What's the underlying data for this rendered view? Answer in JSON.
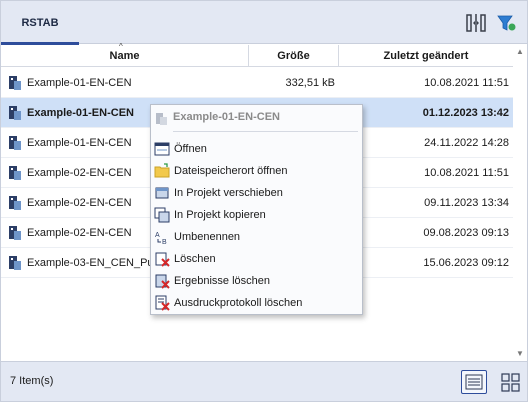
{
  "toolbar": {
    "tab_label": "RSTAB",
    "layout_icon": "split-view-icon",
    "filter_icon": "filter-icon",
    "accent_color": "#2e4d9b"
  },
  "table": {
    "columns": [
      "Name",
      "Größe",
      "Zuletzt geändert"
    ],
    "rows": [
      {
        "name": "Example-01-EN-CEN",
        "size": "332,51 kB",
        "modified": "10.08.2021 11:51",
        "selected": false
      },
      {
        "name": "Example-01-EN-CEN",
        "size": "",
        "modified": "01.12.2023 13:42",
        "selected": true
      },
      {
        "name": "Example-01-EN-CEN",
        "size": "",
        "modified": "24.11.2022 14:28",
        "selected": false
      },
      {
        "name": "Example-02-EN-CEN",
        "size": "",
        "modified": "10.08.2021 11:51",
        "selected": false
      },
      {
        "name": "Example-02-EN-CEN",
        "size": "",
        "modified": "09.11.2023 13:34",
        "selected": false
      },
      {
        "name": "Example-02-EN-CEN",
        "size": "",
        "modified": "09.08.2023 09:13",
        "selected": false
      },
      {
        "name": "Example-03-EN_CEN_Pus",
        "size": "",
        "modified": "15.06.2023 09:12",
        "selected": false
      }
    ],
    "selected_color": "#cfe0f7"
  },
  "context_menu": {
    "title": "Example-01-EN-CEN",
    "items": [
      {
        "label": "Öffnen",
        "icon": "open-window-icon"
      },
      {
        "label": "Dateispeicherort öffnen",
        "icon": "folder-icon"
      },
      {
        "label": "In Projekt verschieben",
        "icon": "move-to-project-icon"
      },
      {
        "label": "In Projekt kopieren",
        "icon": "copy-to-project-icon"
      },
      {
        "label": "Umbenennen",
        "icon": "rename-icon"
      },
      {
        "label": "Löschen",
        "icon": "delete-icon"
      },
      {
        "label": "Ergebnisse löschen",
        "icon": "delete-results-icon"
      },
      {
        "label": "Ausdruckprotokoll löschen",
        "icon": "delete-printout-icon"
      }
    ]
  },
  "status": {
    "item_count": "7 Item(s)",
    "list_view_icon": "list-view-icon",
    "grid_view_icon": "grid-view-icon"
  }
}
